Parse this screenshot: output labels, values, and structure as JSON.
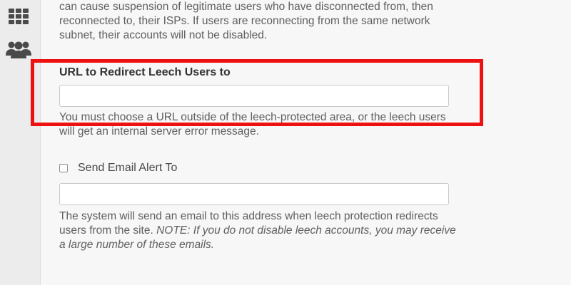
{
  "sidebar": {
    "items": [
      {
        "icon": "apps-grid-icon"
      },
      {
        "icon": "users-group-icon"
      }
    ]
  },
  "main": {
    "intro_text": "can cause suspension of legitimate users who have disconnected from, then reconnected to, their ISPs. If users are reconnecting from the same network subnet, their accounts will not be disabled.",
    "redirect": {
      "label": "URL to Redirect Leech Users to",
      "value": "",
      "help": "You must choose a URL outside of the leech-protected area, or the leech users will get an internal server error message."
    },
    "email_alert": {
      "checkbox_label": "Send Email Alert To",
      "checked": false,
      "value": "",
      "help_plain": "The system will send an email to this address when leech protection redirects users from the site. ",
      "help_note": "NOTE: If you do not disable leech accounts, you may receive a large number of these emails."
    }
  },
  "annotation": {
    "highlight_color": "#ee1111"
  },
  "colors": {
    "background": "#f7f7f7",
    "sidebar_background": "#ececec",
    "icon": "#4a4a4a",
    "help_text": "#5f5f5f",
    "label_text": "#333333"
  }
}
